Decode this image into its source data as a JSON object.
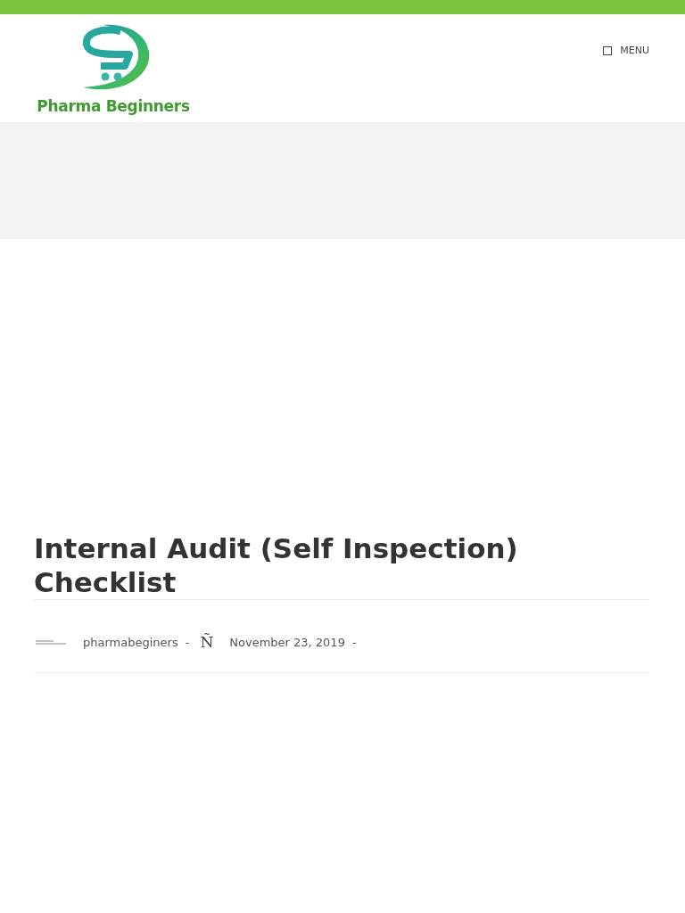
{
  "header": {
    "logo_text": "Pharma Beginners",
    "menu_label": "MENU"
  },
  "article": {
    "title": "Internal Audit (Self Inspection) Checklist",
    "meta": [
      {
        "kind": "author",
        "text": "pharmabeginers",
        "separator": "-"
      },
      {
        "kind": "date",
        "icon_glyph": "Ñ",
        "text": "November 23, 2019",
        "separator": "-"
      }
    ]
  }
}
